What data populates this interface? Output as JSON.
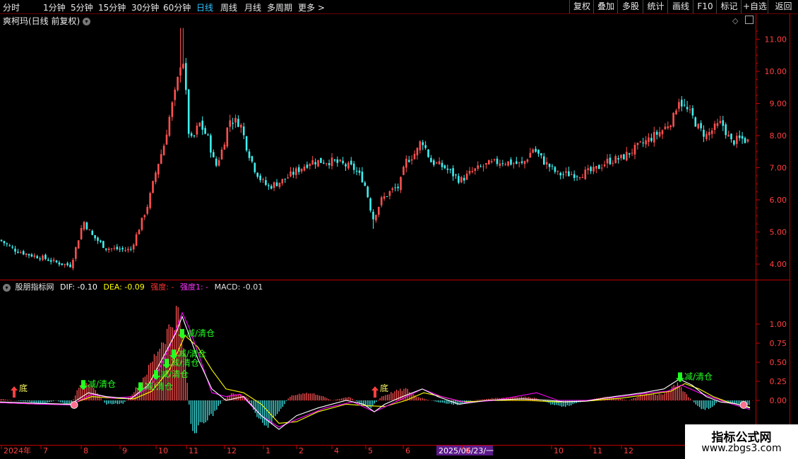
{
  "topbar": {
    "timeframes": [
      "分时",
      "1分钟",
      "5分钟",
      "15分钟",
      "30分钟",
      "60分钟",
      "日线",
      "周线",
      "月线",
      "多周期",
      "更多 >"
    ],
    "active": "日线",
    "right_buttons": [
      "复权",
      "叠加",
      "多股",
      "统计",
      "画线",
      "F10",
      "标记",
      "+自选",
      "返回"
    ]
  },
  "main": {
    "title": "爽柯玛(日线 前复权)",
    "collapse_icon": "chevron-down-icon"
  },
  "indicator": {
    "name": "股朋指标网",
    "dif": "DIF: -0.10",
    "dea": "DEA: -0.09",
    "strength": "强度: -",
    "strength1": "强度1: -",
    "macd": "MACD: -0.01"
  },
  "watermark": {
    "title": "指标公式网",
    "url": "www.zbgs3.com"
  },
  "colors": {
    "up": "#ff4d4d",
    "down": "#00e0e0",
    "dif": "#ffffff",
    "dea": "#ffff00",
    "strength": "#ff00ff",
    "signal_sell": "#22ff22",
    "signal_bottom": "#ffff66",
    "axis": "#800000"
  },
  "chart_data": [
    {
      "type": "candlestick",
      "title": "爽柯玛(日线 前复权)",
      "xlabel": "",
      "ylabel": "",
      "ylim": [
        3.7,
        11.5
      ],
      "yticks": [
        "11.00",
        "10.00",
        "9.00",
        "8.00",
        "7.00",
        "6.00",
        "5.00",
        "4.00"
      ],
      "x_tick_labels": [
        "2024年",
        "7",
        "8",
        "9",
        "10",
        "11",
        "12",
        "1",
        "2",
        "4",
        "5",
        "6",
        "2025/06/23/一",
        "9",
        "10",
        "11",
        "12"
      ],
      "close_path": [
        [
          0,
          4.75
        ],
        [
          20,
          4.45
        ],
        [
          40,
          4.3
        ],
        [
          60,
          4.2
        ],
        [
          80,
          4.05
        ],
        [
          100,
          3.95
        ],
        [
          110,
          4.7
        ],
        [
          118,
          5.35
        ],
        [
          130,
          4.9
        ],
        [
          150,
          4.5
        ],
        [
          175,
          4.45
        ],
        [
          185,
          4.45
        ],
        [
          195,
          5.0
        ],
        [
          210,
          5.9
        ],
        [
          222,
          7.0
        ],
        [
          232,
          7.7
        ],
        [
          242,
          8.8
        ],
        [
          250,
          9.5
        ],
        [
          258,
          10.6
        ],
        [
          262,
          9.8
        ],
        [
          266,
          8.2
        ],
        [
          272,
          7.8
        ],
        [
          282,
          8.4
        ],
        [
          295,
          7.9
        ],
        [
          305,
          7.0
        ],
        [
          315,
          7.6
        ],
        [
          325,
          8.5
        ],
        [
          340,
          8.4
        ],
        [
          350,
          7.6
        ],
        [
          360,
          7.0
        ],
        [
          370,
          6.6
        ],
        [
          380,
          6.4
        ],
        [
          400,
          6.6
        ],
        [
          420,
          6.9
        ],
        [
          440,
          7.2
        ],
        [
          470,
          7.2
        ],
        [
          500,
          7.0
        ],
        [
          515,
          6.6
        ],
        [
          522,
          6.0
        ],
        [
          528,
          5.4
        ],
        [
          540,
          6.0
        ],
        [
          555,
          6.3
        ],
        [
          565,
          6.4
        ],
        [
          575,
          7.2
        ],
        [
          590,
          7.5
        ],
        [
          597,
          7.9
        ],
        [
          610,
          7.2
        ],
        [
          630,
          7.0
        ],
        [
          652,
          6.6
        ],
        [
          670,
          6.9
        ],
        [
          690,
          7.1
        ],
        [
          710,
          7.2
        ],
        [
          740,
          7.1
        ],
        [
          755,
          7.6
        ],
        [
          770,
          7.2
        ],
        [
          790,
          6.8
        ],
        [
          820,
          6.8
        ],
        [
          840,
          6.9
        ],
        [
          860,
          7.2
        ],
        [
          880,
          7.3
        ],
        [
          900,
          7.6
        ],
        [
          920,
          7.9
        ],
        [
          940,
          8.2
        ],
        [
          955,
          8.6
        ],
        [
          960,
          9.2
        ],
        [
          968,
          8.9
        ],
        [
          980,
          8.6
        ],
        [
          990,
          8.2
        ],
        [
          1000,
          8.0
        ],
        [
          1010,
          8.2
        ],
        [
          1022,
          8.4
        ],
        [
          1035,
          7.8
        ],
        [
          1050,
          7.9
        ],
        [
          1062,
          7.8
        ]
      ],
      "notable_extremes": {
        "high": 11.35,
        "low": 3.95,
        "late_low": 5.1
      }
    },
    {
      "type": "bar_line",
      "title": "股朋指标网",
      "ylim": [
        -1.0,
        1.5
      ],
      "yticks": [
        "1.00",
        "0.75",
        "0.50",
        "0.25",
        "0.00"
      ],
      "macd_hist_path": [
        [
          0,
          0.02
        ],
        [
          40,
          -0.02
        ],
        [
          60,
          -0.05
        ],
        [
          80,
          0.0
        ],
        [
          100,
          -0.08
        ],
        [
          110,
          0.15
        ],
        [
          118,
          0.3
        ],
        [
          135,
          0.12
        ],
        [
          150,
          -0.05
        ],
        [
          175,
          -0.04
        ],
        [
          190,
          0.12
        ],
        [
          210,
          0.4
        ],
        [
          225,
          0.7
        ],
        [
          240,
          0.95
        ],
        [
          252,
          1.17
        ],
        [
          262,
          0.6
        ],
        [
          270,
          -0.3
        ],
        [
          275,
          -0.5
        ],
        [
          285,
          -0.3
        ],
        [
          300,
          -0.2
        ],
        [
          315,
          0.0
        ],
        [
          330,
          0.1
        ],
        [
          350,
          0.05
        ],
        [
          365,
          -0.25
        ],
        [
          380,
          -0.35
        ],
        [
          395,
          -0.15
        ],
        [
          410,
          0.05
        ],
        [
          430,
          0.1
        ],
        [
          450,
          0.08
        ],
        [
          470,
          0.0
        ],
        [
          495,
          0.05
        ],
        [
          510,
          -0.05
        ],
        [
          525,
          -0.1
        ],
        [
          540,
          0.05
        ],
        [
          560,
          0.12
        ],
        [
          575,
          0.15
        ],
        [
          590,
          0.05
        ],
        [
          610,
          0.0
        ],
        [
          630,
          -0.04
        ],
        [
          650,
          -0.06
        ],
        [
          670,
          0.0
        ],
        [
          700,
          0.03
        ],
        [
          740,
          0.05
        ],
        [
          760,
          0.03
        ],
        [
          780,
          -0.05
        ],
        [
          800,
          -0.08
        ],
        [
          830,
          0.0
        ],
        [
          860,
          0.05
        ],
        [
          890,
          0.0
        ],
        [
          910,
          0.08
        ],
        [
          940,
          0.08
        ],
        [
          960,
          0.22
        ],
        [
          975,
          0.05
        ],
        [
          990,
          -0.1
        ],
        [
          1005,
          -0.12
        ],
        [
          1020,
          0.02
        ],
        [
          1040,
          -0.05
        ],
        [
          1062,
          -0.06
        ]
      ],
      "dif_path": [
        [
          0,
          -0.02
        ],
        [
          60,
          -0.04
        ],
        [
          100,
          -0.05
        ],
        [
          125,
          0.1
        ],
        [
          150,
          0.05
        ],
        [
          185,
          0.02
        ],
        [
          210,
          0.2
        ],
        [
          230,
          0.55
        ],
        [
          250,
          0.9
        ],
        [
          258,
          1.1
        ],
        [
          266,
          0.9
        ],
        [
          280,
          0.55
        ],
        [
          300,
          0.15
        ],
        [
          320,
          0.0
        ],
        [
          345,
          0.05
        ],
        [
          370,
          -0.2
        ],
        [
          395,
          -0.38
        ],
        [
          420,
          -0.2
        ],
        [
          450,
          -0.1
        ],
        [
          490,
          0.0
        ],
        [
          515,
          -0.05
        ],
        [
          530,
          -0.15
        ],
        [
          545,
          -0.05
        ],
        [
          570,
          0.05
        ],
        [
          598,
          0.15
        ],
        [
          620,
          0.05
        ],
        [
          650,
          -0.05
        ],
        [
          690,
          0.0
        ],
        [
          740,
          0.02
        ],
        [
          780,
          0.0
        ],
        [
          800,
          -0.02
        ],
        [
          830,
          -0.01
        ],
        [
          870,
          0.05
        ],
        [
          910,
          0.1
        ],
        [
          940,
          0.15
        ],
        [
          962,
          0.28
        ],
        [
          980,
          0.2
        ],
        [
          1000,
          0.05
        ],
        [
          1020,
          -0.02
        ],
        [
          1040,
          -0.04
        ],
        [
          1062,
          -0.1
        ]
      ],
      "dea_path": [
        [
          0,
          -0.03
        ],
        [
          60,
          -0.05
        ],
        [
          100,
          -0.05
        ],
        [
          130,
          0.05
        ],
        [
          160,
          0.03
        ],
        [
          190,
          0.02
        ],
        [
          215,
          0.12
        ],
        [
          240,
          0.4
        ],
        [
          262,
          0.85
        ],
        [
          280,
          0.7
        ],
        [
          300,
          0.4
        ],
        [
          320,
          0.15
        ],
        [
          345,
          0.1
        ],
        [
          370,
          -0.05
        ],
        [
          395,
          -0.3
        ],
        [
          420,
          -0.28
        ],
        [
          450,
          -0.15
        ],
        [
          490,
          -0.05
        ],
        [
          520,
          -0.07
        ],
        [
          545,
          -0.08
        ],
        [
          575,
          0.0
        ],
        [
          600,
          0.1
        ],
        [
          625,
          0.05
        ],
        [
          655,
          -0.02
        ],
        [
          700,
          0.0
        ],
        [
          745,
          0.0
        ],
        [
          790,
          -0.02
        ],
        [
          830,
          -0.01
        ],
        [
          880,
          0.03
        ],
        [
          920,
          0.08
        ],
        [
          950,
          0.12
        ],
        [
          970,
          0.22
        ],
        [
          990,
          0.15
        ],
        [
          1010,
          0.05
        ],
        [
          1030,
          -0.02
        ],
        [
          1062,
          -0.09
        ]
      ],
      "strength_path": [
        [
          0,
          -0.03
        ],
        [
          60,
          -0.05
        ],
        [
          100,
          -0.06
        ],
        [
          130,
          0.08
        ],
        [
          160,
          0.03
        ],
        [
          190,
          0.05
        ],
        [
          215,
          0.2
        ],
        [
          240,
          0.7
        ],
        [
          258,
          1.15
        ],
        [
          268,
          0.95
        ],
        [
          285,
          0.5
        ],
        [
          300,
          0.1
        ],
        [
          320,
          0.05
        ],
        [
          340,
          0.08
        ],
        [
          370,
          -0.2
        ],
        [
          395,
          -0.35
        ],
        [
          420,
          -0.25
        ],
        [
          460,
          -0.1
        ],
        [
          500,
          -0.02
        ],
        [
          530,
          -0.15
        ],
        [
          560,
          -0.02
        ],
        [
          598,
          0.15
        ],
        [
          625,
          0.05
        ],
        [
          660,
          -0.03
        ],
        [
          700,
          0.0
        ],
        [
          760,
          0.1
        ],
        [
          790,
          0.0
        ],
        [
          830,
          0.0
        ],
        [
          880,
          0.05
        ],
        [
          920,
          0.1
        ],
        [
          945,
          0.12
        ],
        [
          965,
          0.2
        ],
        [
          990,
          0.1
        ],
        [
          1020,
          0.0
        ],
        [
          1062,
          -0.12
        ]
      ],
      "signals": [
        {
          "label": "底",
          "x": 20,
          "y": 0.0,
          "kind": "bottom"
        },
        {
          "label": "减/清仓",
          "x": 118,
          "y": 0.1,
          "kind": "sell"
        },
        {
          "label": "减/清仓",
          "x": 199,
          "y": 0.07,
          "kind": "sell"
        },
        {
          "label": "减/清仓",
          "x": 221,
          "y": 0.23,
          "kind": "sell"
        },
        {
          "label": "减/清仓",
          "x": 236,
          "y": 0.38,
          "kind": "sell"
        },
        {
          "label": "减/清仓",
          "x": 246,
          "y": 0.5,
          "kind": "sell"
        },
        {
          "label": "减/清仓",
          "x": 258,
          "y": 0.77,
          "kind": "sell"
        },
        {
          "label": "底",
          "x": 531,
          "y": 0.0,
          "kind": "bottom"
        },
        {
          "label": "减/清仓",
          "x": 963,
          "y": 0.2,
          "kind": "sell"
        }
      ]
    }
  ]
}
